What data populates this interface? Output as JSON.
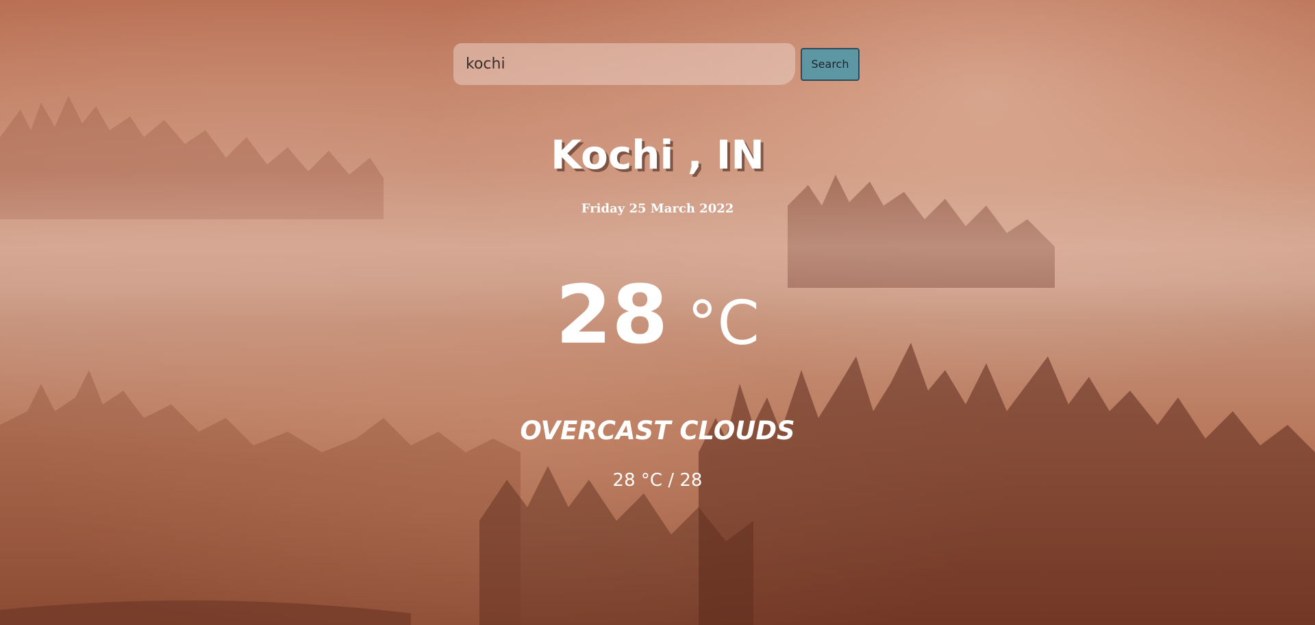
{
  "search": {
    "value": "kochi",
    "button_label": "Search"
  },
  "weather": {
    "location": "Kochi , IN",
    "date": "Friday 25 March 2022",
    "temperature": "28",
    "unit": "°C",
    "condition": "OVERCAST CLOUDS",
    "range": "28 °C / 28"
  },
  "colors": {
    "search_button_bg": "#5d97a3",
    "text": "#ffffff",
    "background_tone": "#c88a6e"
  }
}
